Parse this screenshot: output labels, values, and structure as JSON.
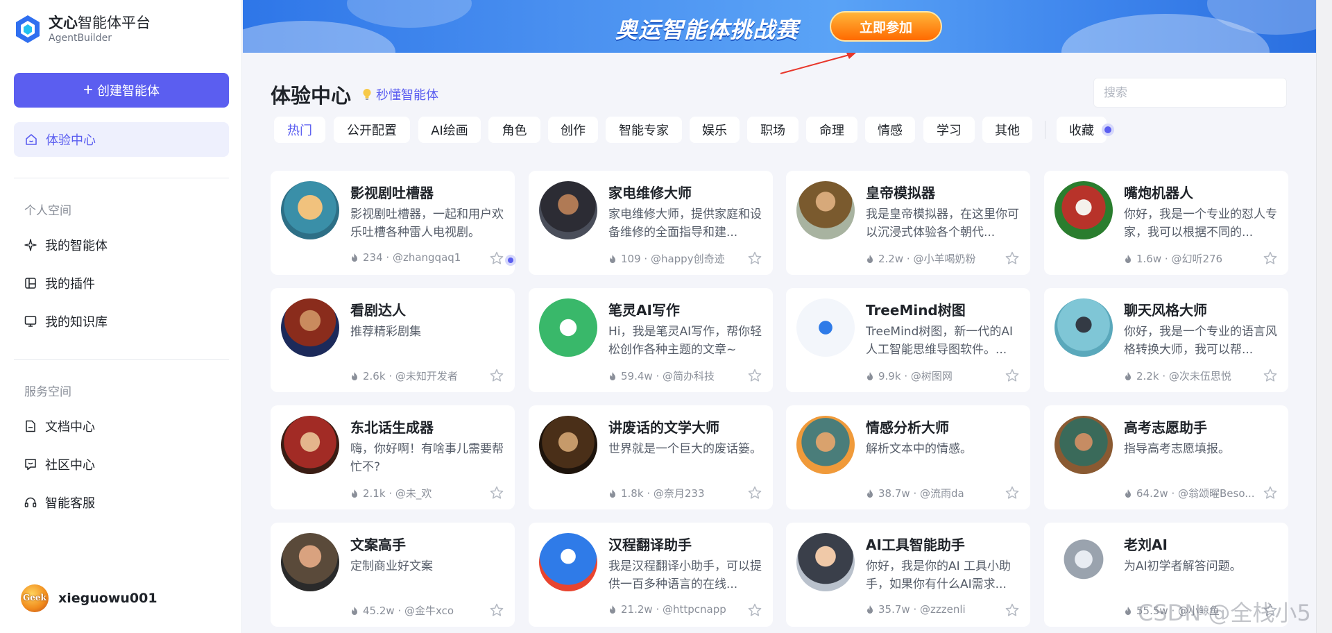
{
  "sidebar": {
    "brand_title_bold": "文心",
    "brand_title_light": "智能体平台",
    "brand_sub": "AgentBuilder",
    "create_label": "创建智能体",
    "active_item": "体验中心",
    "section_personal": "个人空间",
    "personal_items": [
      {
        "label": "我的智能体",
        "icon": "sparkle-icon"
      },
      {
        "label": "我的插件",
        "icon": "plugin-icon"
      },
      {
        "label": "我的知识库",
        "icon": "monitor-icon"
      }
    ],
    "section_service": "服务空间",
    "service_items": [
      {
        "label": "文档中心",
        "icon": "document-icon"
      },
      {
        "label": "社区中心",
        "icon": "chat-icon"
      },
      {
        "label": "智能客服",
        "icon": "headset-icon"
      }
    ],
    "user_name": "xieguowu001",
    "user_avatar_text": "Geek"
  },
  "banner": {
    "title": "奥运智能体挑战赛",
    "button": "立即参加"
  },
  "main": {
    "title": "体验中心",
    "hint": "秒懂智能体",
    "search_placeholder": "搜索",
    "tabs": [
      "热门",
      "公开配置",
      "AI绘画",
      "角色",
      "创作",
      "智能专家",
      "娱乐",
      "职场",
      "命理",
      "情感",
      "学习",
      "其他"
    ],
    "fav_tab": "收藏",
    "accent": "#5b5ef0"
  },
  "cards": [
    {
      "name": "影视剧吐槽器",
      "desc": "影视剧吐槽器，一起和用户欢乐吐槽各种雷人电视剧。",
      "count": "234",
      "author": "@zhangqaq1"
    },
    {
      "name": "家电维修大师",
      "desc": "家电维修大师，提供家庭和设备维修的全面指导和建...",
      "count": "109",
      "author": "@happy创奇迹"
    },
    {
      "name": "皇帝模拟器",
      "desc": "我是皇帝模拟器，在这里你可以沉浸式体验各个朝代...",
      "count": "2.2w",
      "author": "@小羊喝奶粉"
    },
    {
      "name": "嘴炮机器人",
      "desc": "你好，我是一个专业的怼人专家，我可以根据不同的...",
      "count": "1.6w",
      "author": "@幻听276"
    },
    {
      "name": "看剧达人",
      "desc": "推荐精彩剧集",
      "count": "2.6k",
      "author": "@未知开发者"
    },
    {
      "name": "笔灵AI写作",
      "desc": "Hi，我是笔灵AI写作，帮你轻松创作各种主题的文章~",
      "count": "59.4w",
      "author": "@简办科技"
    },
    {
      "name": "TreeMind树图",
      "desc": "TreeMind树图，新一代的AI人工智能思维导图软件。...",
      "count": "9.9k",
      "author": "@树图网"
    },
    {
      "name": "聊天风格大师",
      "desc": "你好，我是一个专业的语言风格转换大师，我可以帮...",
      "count": "2.2k",
      "author": "@次未伍思悦"
    },
    {
      "name": "东北话生成器",
      "desc": "嗨，你好啊！有啥事儿需要帮忙不?",
      "count": "2.1k",
      "author": "@未_欢"
    },
    {
      "name": "讲废话的文学大师",
      "desc": "世界就是一个巨大的废话篓。",
      "count": "1.8k",
      "author": "@奈月233"
    },
    {
      "name": "情感分析大师",
      "desc": "解析文本中的情感。",
      "count": "38.7w",
      "author": "@流雨da"
    },
    {
      "name": "高考志愿助手",
      "desc": "指导高考志愿填报。",
      "count": "64.2w",
      "author": "@翁颂曜Beso..."
    },
    {
      "name": "文案高手",
      "desc": "定制商业好文案",
      "count": "45.2w",
      "author": "@金牛xco"
    },
    {
      "name": "汉程翻译助手",
      "desc": "我是汉程翻译小助手，可以提供一百多种语言的在线...",
      "count": "21.2w",
      "author": "@httpcnapp"
    },
    {
      "name": "AI工具智能助手",
      "desc": "你好，我是你的AI 工具小助手，如果你有什么AI需求...",
      "count": "35.7w",
      "author": "@zzzenli"
    },
    {
      "name": "老刘AI",
      "desc": "为AI初学者解答问题。",
      "count": "55.5w",
      "author": "@小鲸鱼"
    }
  ],
  "watermark": "CSDN @全栈小5"
}
